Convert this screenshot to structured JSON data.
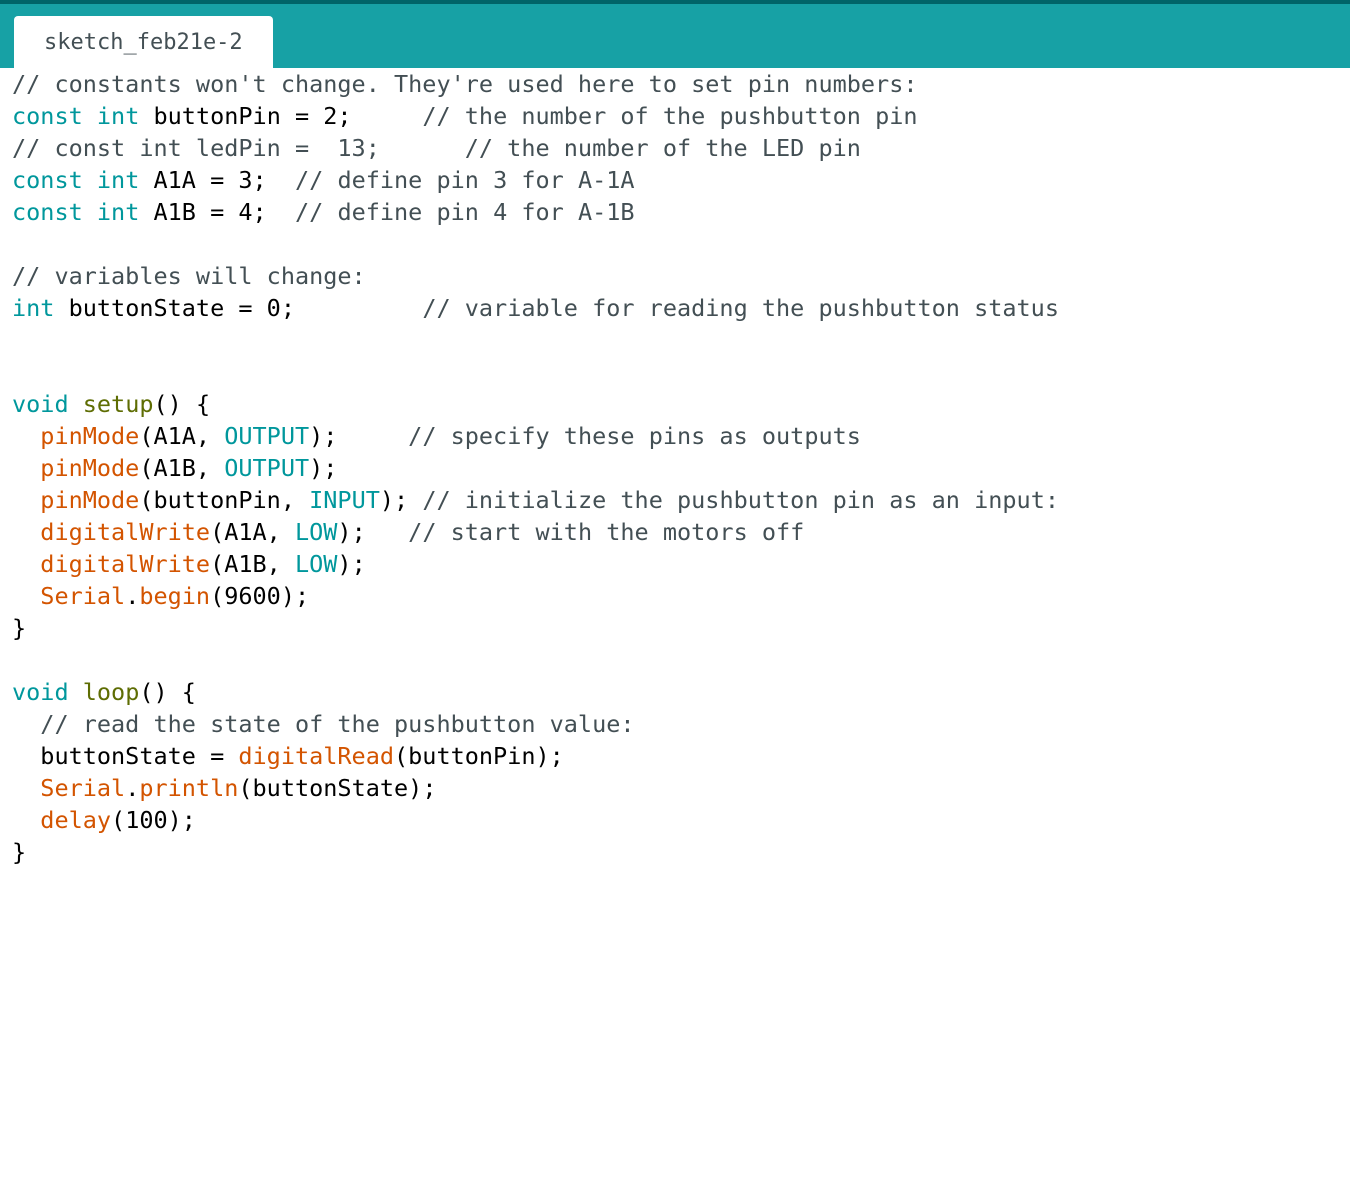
{
  "app": {
    "tab_title": "sketch_feb21e-2"
  },
  "colors": {
    "tab_bar": "#17a1a5",
    "top_edge": "#006468",
    "tab_background": "#ffffff",
    "editor_background": "#ffffff",
    "comment": "#434f54",
    "keyword": "#00979c",
    "function": "#5e6d03",
    "builtin": "#d35400",
    "constant": "#00979c",
    "plain": "#000000"
  },
  "code": {
    "lines": [
      [
        {
          "t": "comment",
          "v": "// constants won't change. They're used here to set pin numbers:"
        }
      ],
      [
        {
          "t": "keyword",
          "v": "const"
        },
        {
          "t": "plain",
          "v": " "
        },
        {
          "t": "keyword",
          "v": "int"
        },
        {
          "t": "plain",
          "v": " buttonPin = 2;     "
        },
        {
          "t": "comment",
          "v": "// the number of the pushbutton pin"
        }
      ],
      [
        {
          "t": "comment",
          "v": "// const int ledPin =  13;      // the number of the LED pin"
        }
      ],
      [
        {
          "t": "keyword",
          "v": "const"
        },
        {
          "t": "plain",
          "v": " "
        },
        {
          "t": "keyword",
          "v": "int"
        },
        {
          "t": "plain",
          "v": " A1A = 3;  "
        },
        {
          "t": "comment",
          "v": "// define pin 3 for A-1A"
        }
      ],
      [
        {
          "t": "keyword",
          "v": "const"
        },
        {
          "t": "plain",
          "v": " "
        },
        {
          "t": "keyword",
          "v": "int"
        },
        {
          "t": "plain",
          "v": " A1B = 4;  "
        },
        {
          "t": "comment",
          "v": "// define pin 4 for A-1B"
        }
      ],
      [],
      [
        {
          "t": "comment",
          "v": "// variables will change:"
        }
      ],
      [
        {
          "t": "keyword",
          "v": "int"
        },
        {
          "t": "plain",
          "v": " buttonState = 0;         "
        },
        {
          "t": "comment",
          "v": "// variable for reading the pushbutton status"
        }
      ],
      [],
      [],
      [
        {
          "t": "keyword",
          "v": "void"
        },
        {
          "t": "plain",
          "v": " "
        },
        {
          "t": "func",
          "v": "setup"
        },
        {
          "t": "plain",
          "v": "() {"
        }
      ],
      [
        {
          "t": "plain",
          "v": "  "
        },
        {
          "t": "builtin",
          "v": "pinMode"
        },
        {
          "t": "plain",
          "v": "(A1A, "
        },
        {
          "t": "const",
          "v": "OUTPUT"
        },
        {
          "t": "plain",
          "v": ");     "
        },
        {
          "t": "comment",
          "v": "// specify these pins as outputs"
        }
      ],
      [
        {
          "t": "plain",
          "v": "  "
        },
        {
          "t": "builtin",
          "v": "pinMode"
        },
        {
          "t": "plain",
          "v": "(A1B, "
        },
        {
          "t": "const",
          "v": "OUTPUT"
        },
        {
          "t": "plain",
          "v": ");"
        }
      ],
      [
        {
          "t": "plain",
          "v": "  "
        },
        {
          "t": "builtin",
          "v": "pinMode"
        },
        {
          "t": "plain",
          "v": "(buttonPin, "
        },
        {
          "t": "const",
          "v": "INPUT"
        },
        {
          "t": "plain",
          "v": "); "
        },
        {
          "t": "comment",
          "v": "// initialize the pushbutton pin as an input:"
        }
      ],
      [
        {
          "t": "plain",
          "v": "  "
        },
        {
          "t": "builtin",
          "v": "digitalWrite"
        },
        {
          "t": "plain",
          "v": "(A1A, "
        },
        {
          "t": "const",
          "v": "LOW"
        },
        {
          "t": "plain",
          "v": ");   "
        },
        {
          "t": "comment",
          "v": "// start with the motors off"
        }
      ],
      [
        {
          "t": "plain",
          "v": "  "
        },
        {
          "t": "builtin",
          "v": "digitalWrite"
        },
        {
          "t": "plain",
          "v": "(A1B, "
        },
        {
          "t": "const",
          "v": "LOW"
        },
        {
          "t": "plain",
          "v": ");"
        }
      ],
      [
        {
          "t": "plain",
          "v": "  "
        },
        {
          "t": "builtin",
          "v": "Serial"
        },
        {
          "t": "plain",
          "v": "."
        },
        {
          "t": "builtin",
          "v": "begin"
        },
        {
          "t": "plain",
          "v": "(9600);"
        }
      ],
      [
        {
          "t": "plain",
          "v": "}"
        }
      ],
      [],
      [
        {
          "t": "keyword",
          "v": "void"
        },
        {
          "t": "plain",
          "v": " "
        },
        {
          "t": "func",
          "v": "loop"
        },
        {
          "t": "plain",
          "v": "() {"
        }
      ],
      [
        {
          "t": "plain",
          "v": "  "
        },
        {
          "t": "comment",
          "v": "// read the state of the pushbutton value:"
        }
      ],
      [
        {
          "t": "plain",
          "v": "  buttonState = "
        },
        {
          "t": "builtin",
          "v": "digitalRead"
        },
        {
          "t": "plain",
          "v": "(buttonPin);"
        }
      ],
      [
        {
          "t": "plain",
          "v": "  "
        },
        {
          "t": "builtin",
          "v": "Serial"
        },
        {
          "t": "plain",
          "v": "."
        },
        {
          "t": "builtin",
          "v": "println"
        },
        {
          "t": "plain",
          "v": "(buttonState);"
        }
      ],
      [
        {
          "t": "plain",
          "v": "  "
        },
        {
          "t": "builtin",
          "v": "delay"
        },
        {
          "t": "plain",
          "v": "(100);"
        }
      ],
      [
        {
          "t": "plain",
          "v": "}"
        }
      ]
    ]
  }
}
